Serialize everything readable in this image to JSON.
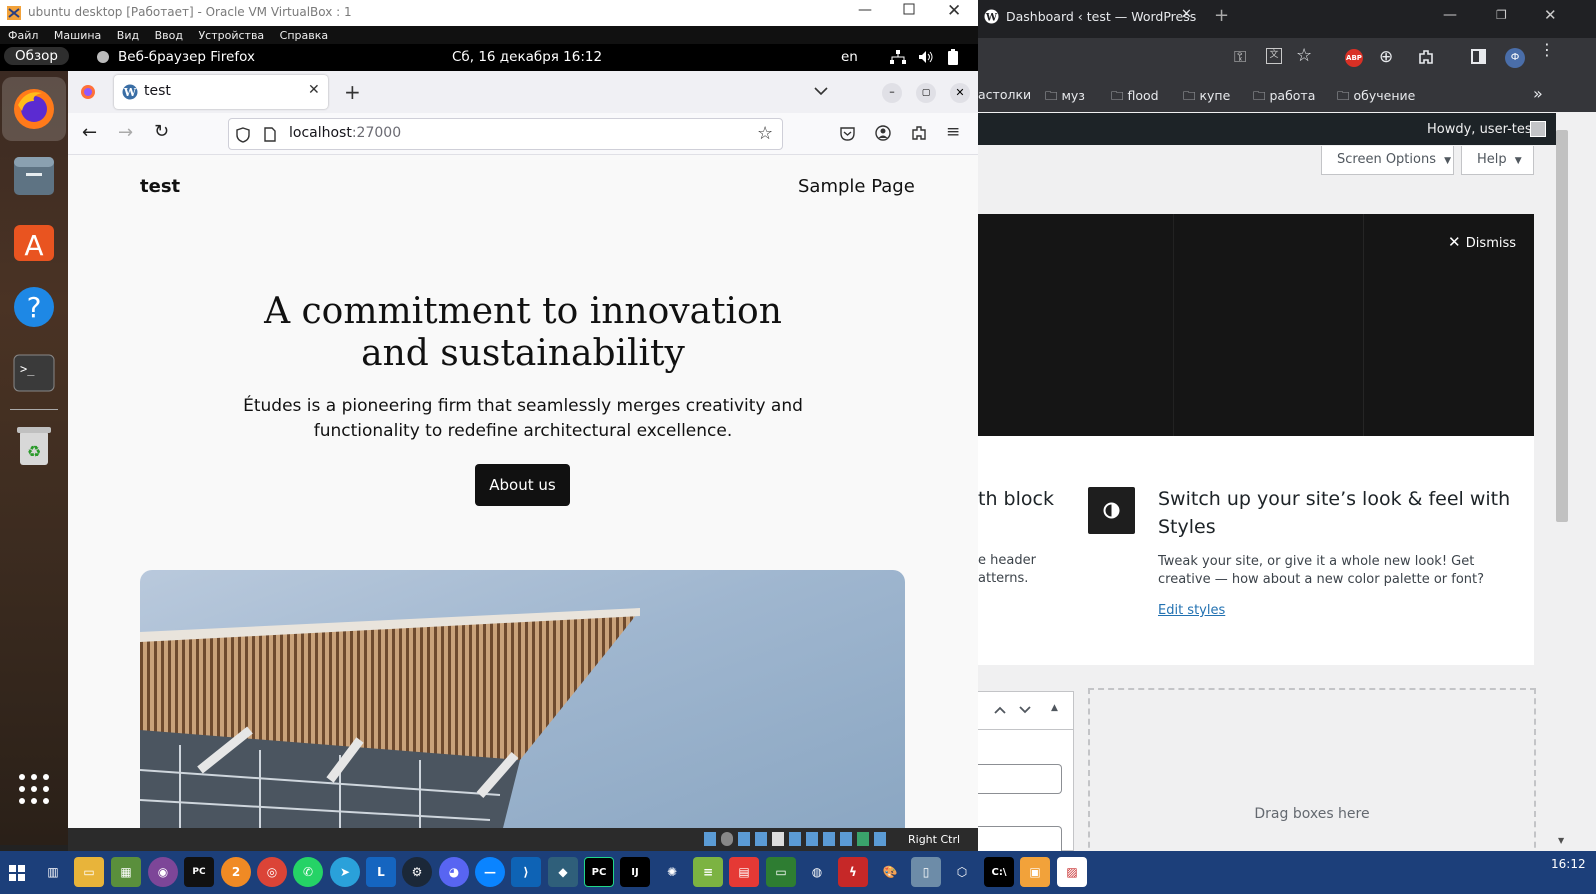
{
  "vbox": {
    "title": "ubuntu desktop [Работает] - Oracle VM VirtualBox : 1",
    "menu": [
      "Файл",
      "Машина",
      "Вид",
      "Ввод",
      "Устройства",
      "Справка"
    ],
    "status_host_key": "Right Ctrl"
  },
  "ubuntu": {
    "overview": "Обзор",
    "app_name": "Веб-браузер Firefox",
    "clock": "Сб, 16 декабря  16:12",
    "lang": "en"
  },
  "firefox": {
    "tab_title": "test",
    "url_host": "localhost",
    "url_port": ":27000"
  },
  "site": {
    "site_title": "test",
    "nav_link": "Sample Page",
    "hero_heading_line1": "A commitment to innovation",
    "hero_heading_line2": "and sustainability",
    "hero_text_line1": "Études is a pioneering firm that seamlessly merges creativity and",
    "hero_text_line2": "functionality to redefine architectural excellence.",
    "cta_label": "About us"
  },
  "chrome": {
    "tab_title": "Dashboard ‹ test — WordPress",
    "bookmarks": [
      "астолки",
      "муз",
      "flood",
      "купе",
      "работа",
      "обучение"
    ]
  },
  "wp": {
    "howdy": "Howdy, user-test",
    "screen_options": "Screen Options",
    "help": "Help",
    "dismiss": "Dismiss",
    "left_card_title_fragment": "th block",
    "left_card_text_line1": "e header",
    "left_card_text_line2": "atterns.",
    "styles_title_line1": "Switch up your site’s look & feel with",
    "styles_title_line2": "Styles",
    "styles_text_line1": "Tweak your site, or give it a whole new look! Get",
    "styles_text_line2": "creative — how about a new color palette or font?",
    "edit_styles": "Edit styles",
    "drag_boxes": "Drag boxes here"
  },
  "taskbar": {
    "clock": "16:12"
  },
  "colors": {
    "taskbar": "#1c3f7a",
    "wp_admin_bar": "#1d2327",
    "wp_link": "#2271b1",
    "site_button": "#111111"
  }
}
